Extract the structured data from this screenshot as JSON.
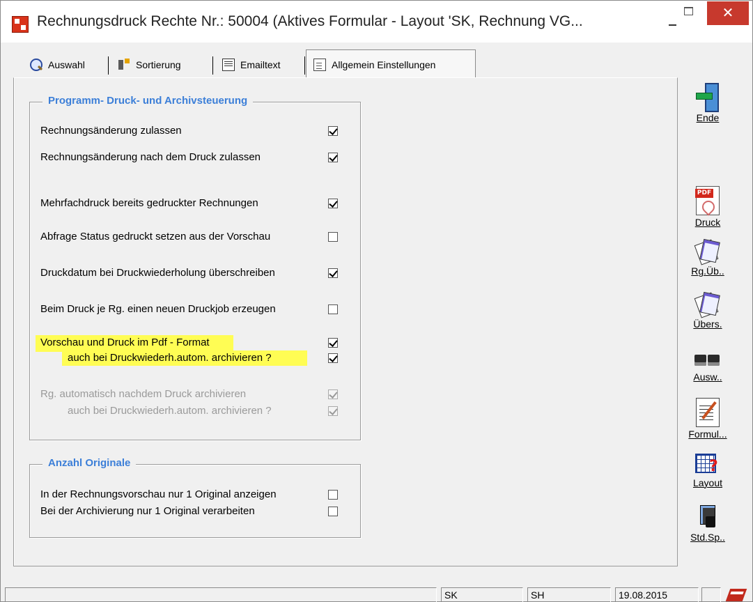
{
  "window": {
    "title": "Rechnungsdruck Rechte Nr.: 50004    (Aktives Formular - Layout 'SK, Rechnung VG...",
    "close_glyph": "✕"
  },
  "tabs": [
    {
      "label": "Auswahl",
      "icon": "search-icon"
    },
    {
      "label": "Sortierung",
      "icon": "sort-icon"
    },
    {
      "label": "Emailtext",
      "icon": "mail-icon"
    },
    {
      "label": "Allgemein Einstellungen",
      "icon": "document-icon",
      "active": true
    }
  ],
  "group1": {
    "title": "Programm- Druck- und Archivsteuerung",
    "options": [
      {
        "label": "Rechnungsänderung zulassen",
        "checked": true
      },
      {
        "label": "Rechnungsänderung nach dem Druck zulassen",
        "checked": true
      },
      {
        "label": "Mehrfachdruck bereits gedruckter Rechnungen",
        "checked": true
      },
      {
        "label": "Abfrage Status gedruckt setzen aus der Vorschau",
        "checked": false
      },
      {
        "label": "Druckdatum bei Druckwiederholung überschreiben",
        "checked": true
      },
      {
        "label": "Beim Druck je Rg. einen neuen Druckjob erzeugen",
        "checked": false
      },
      {
        "label": "Vorschau und Druck im Pdf - Format",
        "checked": true,
        "highlighted": true
      },
      {
        "label": "auch bei Druckwiederh.autom. archivieren ?",
        "checked": true,
        "highlighted": true
      },
      {
        "label": "Rg. automatisch nachdem Druck archivieren",
        "checked": true,
        "disabled": true
      },
      {
        "label": "auch bei Druckwiederh.autom. archivieren ?",
        "checked": true,
        "disabled": true
      }
    ]
  },
  "group2": {
    "title": "Anzahl Originale",
    "options": [
      {
        "label": "In der Rechnungsvorschau nur 1 Original anzeigen",
        "checked": false
      },
      {
        "label": "Bei der Archivierung nur 1 Original verarbeiten",
        "checked": false
      }
    ]
  },
  "toolbar": {
    "ende": "Ende",
    "druck": "Druck",
    "rg_ub": "Rg.Üb..",
    "ubers": "Übers.",
    "ausw": "Ausw..",
    "formul": "Formul...",
    "layout": "Layout",
    "std_sp": "Std.Sp.."
  },
  "statusbar": {
    "field1": "",
    "field2": "SK",
    "field3": "SH",
    "date": "19.08.2015",
    "field5": ""
  },
  "colors": {
    "group_title": "#3c7fd8",
    "highlight": "#fffd54",
    "close_button": "#c7392d"
  }
}
